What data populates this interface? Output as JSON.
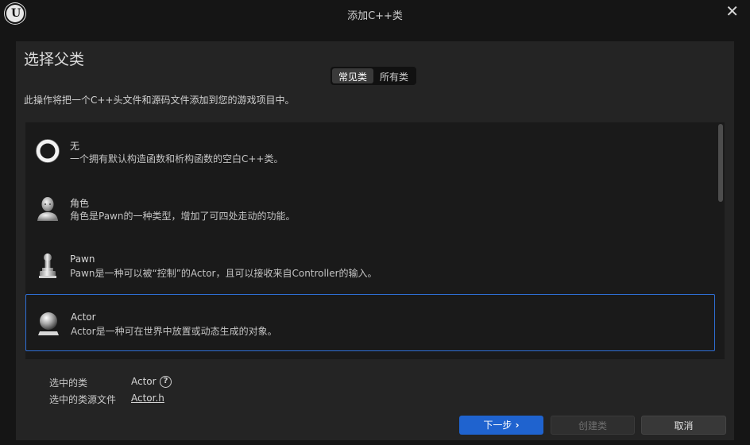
{
  "window": {
    "title": "添加C++类",
    "logo_icon": "unreal-engine-logo",
    "close_label": "✕"
  },
  "page_title": "选择父类",
  "tabs": [
    {
      "label": "常见类",
      "active": true
    },
    {
      "label": "所有类",
      "active": false
    }
  ],
  "description": "此操作将把一个C++头文件和源码文件添加到您的游戏项目中。",
  "classes": [
    {
      "name": "无",
      "description": "一个拥有默认构造函数和析构函数的空白C++类。",
      "icon": "empty-ring-icon",
      "selected": false
    },
    {
      "name": "角色",
      "description": "角色是Pawn的一种类型，增加了可四处走动的功能。",
      "icon": "character-icon",
      "selected": false
    },
    {
      "name": "Pawn",
      "description": "Pawn是一种可以被“控制”的Actor，且可以接收来自Controller的输入。",
      "icon": "pawn-icon",
      "selected": false
    },
    {
      "name": "Actor",
      "description": "Actor是一种可在世界中放置或动态生成的对象。",
      "icon": "actor-sphere-icon",
      "selected": true
    }
  ],
  "selection": {
    "class_label": "选中的类",
    "class_value": "Actor",
    "source_label": "选中的类源文件",
    "source_value": "Actor.h"
  },
  "buttons": {
    "next": "下一步",
    "create": "创建类",
    "cancel": "取消"
  },
  "colors": {
    "accent": "#1f63cf",
    "selection_border": "#2f6fd6",
    "background": "#151515",
    "panel": "#242424"
  }
}
